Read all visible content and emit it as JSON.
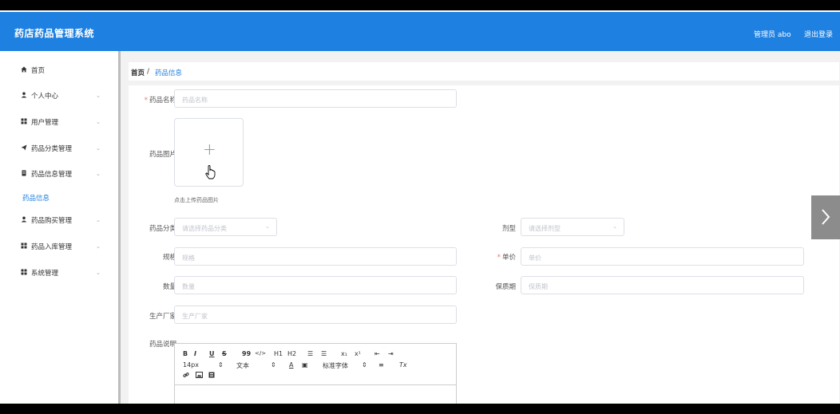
{
  "header": {
    "brand": "药店药品管理系统",
    "user": "管理员 abo",
    "logout": "退出登录",
    "bg_color": "#1e80e0"
  },
  "sidebar": {
    "items": [
      {
        "label": "首页",
        "icon": "home-icon",
        "glyph": "⌂",
        "chevron": false
      },
      {
        "label": "个人中心",
        "icon": "user-icon",
        "glyph": "●",
        "chevron": true
      },
      {
        "label": "用户管理",
        "icon": "grid-icon",
        "glyph": "▪▪",
        "chevron": true
      },
      {
        "label": "药品分类管理",
        "icon": "send-icon",
        "glyph": "➤",
        "chevron": true
      },
      {
        "label": "药品信息管理",
        "icon": "file-icon",
        "glyph": "▮",
        "chevron": true
      },
      {
        "label": "药品购买管理",
        "icon": "user-icon",
        "glyph": "●",
        "chevron": true
      },
      {
        "label": "药品入库管理",
        "icon": "grid-icon",
        "glyph": "▪▪",
        "chevron": true
      },
      {
        "label": "系统管理",
        "icon": "grid-icon",
        "glyph": "▪▪",
        "chevron": true
      }
    ],
    "submenu_active": "药品信息"
  },
  "breadcrumb": {
    "home": "首页",
    "sep": "/",
    "current": "药品信息"
  },
  "form": {
    "name": {
      "label": "药品名称",
      "placeholder": "药品名称",
      "required": "*"
    },
    "image": {
      "label": "药品图片",
      "hint": "点击上传药品图片"
    },
    "category": {
      "label": "药品分类",
      "placeholder": "请选择药品分类"
    },
    "dosage": {
      "label": "剂型",
      "placeholder": "请选择剂型"
    },
    "spec": {
      "label": "规格",
      "placeholder": "规格"
    },
    "price": {
      "label": "单价",
      "placeholder": "单价",
      "required": "*"
    },
    "quantity": {
      "label": "数量",
      "placeholder": "数量"
    },
    "shelf": {
      "label": "保质期",
      "placeholder": "保质期"
    },
    "maker": {
      "label": "生产厂家",
      "placeholder": "生产厂家"
    },
    "desc": {
      "label": "药品说明"
    }
  },
  "editor": {
    "bold": "B",
    "italic": "I",
    "underline": "U",
    "strike": "S",
    "quote": "99",
    "code": "</>",
    "h1": "H1",
    "h2": "H2",
    "ol": "☰",
    "ul": "☰",
    "sub": "x₁",
    "sup": "x¹",
    "outdent": "⇤",
    "indent": "⇥",
    "size": "14px",
    "size_arrow": "⇕",
    "type": "文本",
    "type_arrow": "⇕",
    "color": "A",
    "bgcolor": "▣",
    "font": "标准字体",
    "font_arrow": "⇕",
    "align": "≡",
    "clear": "Tx",
    "link": "🔗",
    "image": "▣",
    "video": "▤"
  }
}
